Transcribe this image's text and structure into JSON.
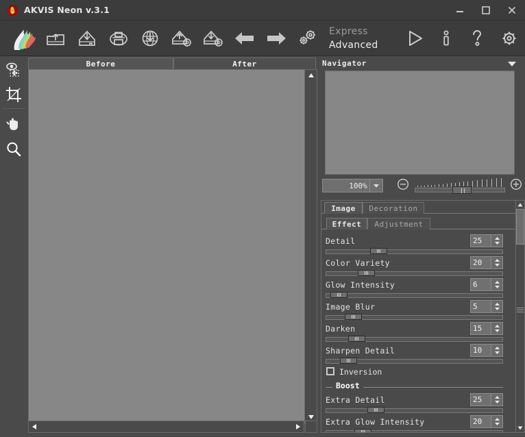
{
  "window": {
    "title": "AKVIS Neon v.3.1",
    "app_icon": "akvis-flame-icon",
    "minimize": "minimize-icon",
    "maximize": "maximize-icon",
    "close": "close-icon"
  },
  "toolbar": {
    "logo": "akvis-neon-logo",
    "items": [
      {
        "name": "open-image",
        "icon": "folder-open-icon"
      },
      {
        "name": "save-image",
        "icon": "save-disk-icon"
      },
      {
        "name": "print-image",
        "icon": "printer-icon"
      },
      {
        "name": "publish-web",
        "icon": "globe-download-icon"
      },
      {
        "name": "load-preset",
        "icon": "preset-load-icon"
      },
      {
        "name": "save-preset",
        "icon": "preset-save-icon"
      },
      {
        "name": "undo",
        "icon": "arrow-left-icon"
      },
      {
        "name": "redo",
        "icon": "arrow-right-icon"
      },
      {
        "name": "preferences",
        "icon": "gears-icon"
      }
    ],
    "mode_express": "Express",
    "mode_advanced": "Advanced",
    "right_items": [
      {
        "name": "run-button",
        "icon": "play-triangle-icon"
      },
      {
        "name": "about-button",
        "icon": "info-icon"
      },
      {
        "name": "help-button",
        "icon": "question-mark-icon"
      },
      {
        "name": "settings-button",
        "icon": "gear-icon"
      }
    ]
  },
  "left_tools": [
    {
      "name": "transform-tool",
      "icon": "eye-move-icon"
    },
    {
      "name": "crop-tool",
      "icon": "crop-icon"
    },
    {
      "name": "hand-tool",
      "icon": "hand-icon"
    },
    {
      "name": "zoom-tool",
      "icon": "magnifier-icon"
    }
  ],
  "image_pane": {
    "tabs": [
      {
        "label": "Before",
        "active": true
      },
      {
        "label": "After",
        "active": false
      }
    ],
    "canvas_color": "#878787",
    "scroll_up": "scroll-up-arrow-icon",
    "scroll_down": "scroll-down-arrow-icon",
    "scroll_left": "scroll-left-arrow-icon",
    "scroll_right": "scroll-right-arrow-icon"
  },
  "navigator": {
    "title": "Navigator",
    "collapse_icon": "chevron-down-icon",
    "zoom_value": "100%",
    "zoom_dropdown_icon": "chevron-down-icon",
    "zoom_out_icon": "minus-circle-icon",
    "zoom_in_icon": "plus-circle-icon",
    "slider_percent": 42
  },
  "settings": {
    "primary_tabs": [
      {
        "label": "Image",
        "active": true
      },
      {
        "label": "Decoration",
        "active": false
      }
    ],
    "secondary_tabs": [
      {
        "label": "Effect",
        "active": true
      },
      {
        "label": "Adjustment",
        "active": false
      }
    ],
    "parameters": [
      {
        "label": "Detail",
        "value": "25",
        "slider_percent": 25
      },
      {
        "label": "Color Variety",
        "value": "20",
        "slider_percent": 20
      },
      {
        "label": "Glow Intensity",
        "value": "6",
        "slider_percent": 6
      },
      {
        "label": "Image Blur",
        "value": "5",
        "slider_percent": 15
      },
      {
        "label": "Darken",
        "value": "15",
        "slider_percent": 15
      },
      {
        "label": "Sharpen Detail",
        "value": "10",
        "slider_percent": 10
      }
    ],
    "inversion": {
      "label": "Inversion",
      "checked": false
    },
    "boost_group": "Boost",
    "boost_parameters": [
      {
        "label": "Extra Detail",
        "value": "25",
        "slider_percent": 25
      },
      {
        "label": "Extra Glow Intensity",
        "value": "20",
        "slider_percent": 20
      }
    ],
    "scroll_up": "scroll-up-arrow-icon",
    "scroll_down": "scroll-down-arrow-icon"
  },
  "colors": {
    "window_bg": "#3c3c3c",
    "panel_bg": "#4a4a4a",
    "canvas_bg": "#878787",
    "text": "#e8e8e8",
    "muted_text": "#9a9a9a",
    "border": "#6b6b6b"
  }
}
